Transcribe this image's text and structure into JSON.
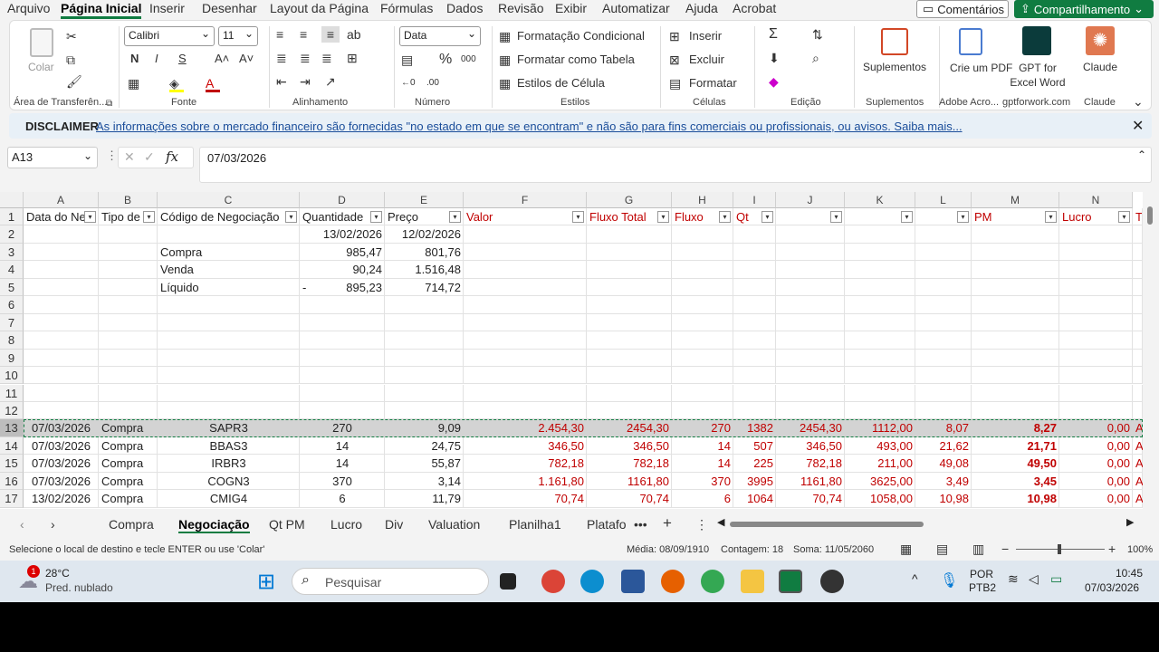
{
  "menu": [
    "Arquivo",
    "Página Inicial",
    "Inserir",
    "Desenhar",
    "Layout da Página",
    "Fórmulas",
    "Dados",
    "Revisão",
    "Exibir",
    "Automatizar",
    "Ajuda",
    "Acrobat"
  ],
  "comments_label": "Comentários",
  "share_label": "Compartilhamento",
  "ribbon": {
    "paste": "Colar",
    "clipboard": "Área de Transferên...",
    "font_name": "Calibri",
    "font_size": "11",
    "font_group": "Fonte",
    "align_group": "Alinhamento",
    "number_format": "Data",
    "number_group": "Número",
    "cond_format": "Formatação Condicional",
    "format_table": "Formatar como Tabela",
    "cell_styles": "Estilos de Célula",
    "styles_group": "Estilos",
    "insert": "Inserir",
    "delete": "Excluir",
    "format": "Formatar",
    "cells_group": "Células",
    "edit_group": "Edição",
    "addins": "Suplementos",
    "addins_group": "Suplementos",
    "pdf": "Crie um PDF",
    "pdf_group": "Adobe Acro...",
    "gpt": "GPT for Excel Word",
    "gpt_group": "gptforwork.com",
    "claude": "Claude",
    "claude_group": "Claude",
    "accent": "#107c41"
  },
  "disclaimer": {
    "title": "DISCLAIMER",
    "text": "As informações sobre o mercado financeiro são fornecidas \"no estado em que se encontram\" e não são para fins comerciais ou profissionais, ou avisos. Saiba mais..."
  },
  "formula": {
    "cell": "A13",
    "value": "07/03/2026"
  },
  "columns": [
    "A",
    "B",
    "C",
    "D",
    "E",
    "F",
    "G",
    "H",
    "I",
    "J",
    "K",
    "L",
    "M",
    "N"
  ],
  "rows": [
    "1",
    "2",
    "3",
    "4",
    "5",
    "6",
    "7",
    "8",
    "9",
    "10",
    "11",
    "12",
    "13",
    "14",
    "15",
    "16",
    "17"
  ],
  "headers": [
    "Data do Ne",
    "Tipo de",
    "Código de Negociação",
    "Quantidade",
    "Preço",
    "Valor",
    "Fluxo Total",
    "Fluxo",
    "Qt",
    "",
    "",
    "",
    "PM",
    "Lucro",
    "T"
  ],
  "summary": {
    "d2": "13/02/2026",
    "e2": "12/02/2026",
    "c3": "Compra",
    "d3": "985,47",
    "e3": "801,76",
    "c4": "Venda",
    "d4": "90,24",
    "e4": "1.516,48",
    "c5": "Líquido",
    "d5_sign": "-",
    "d5": "895,23",
    "e5": "714,72"
  },
  "data_rows": [
    [
      "07/03/2026",
      "Compra",
      "SAPR3",
      "270",
      "9,09",
      "2.454,30",
      "2454,30",
      "270",
      "1382",
      "2454,30",
      "1112,00",
      "8,07",
      "8,27",
      "0,00",
      "A"
    ],
    [
      "07/03/2026",
      "Compra",
      "BBAS3",
      "14",
      "24,75",
      "346,50",
      "346,50",
      "14",
      "507",
      "346,50",
      "493,00",
      "21,62",
      "21,71",
      "0,00",
      "A"
    ],
    [
      "07/03/2026",
      "Compra",
      "IRBR3",
      "14",
      "55,87",
      "782,18",
      "782,18",
      "14",
      "225",
      "782,18",
      "211,00",
      "49,08",
      "49,50",
      "0,00",
      "A"
    ],
    [
      "07/03/2026",
      "Compra",
      "COGN3",
      "370",
      "3,14",
      "1.161,80",
      "1161,80",
      "370",
      "3995",
      "1161,80",
      "3625,00",
      "3,49",
      "3,45",
      "0,00",
      "A"
    ],
    [
      "13/02/2026",
      "Compra",
      "CMIG4",
      "6",
      "11,79",
      "70,74",
      "70,74",
      "6",
      "1064",
      "70,74",
      "1058,00",
      "10,98",
      "10,98",
      "0,00",
      "A"
    ]
  ],
  "tabs": [
    "Compra",
    "Negociação",
    "Qt PM",
    "Lucro",
    "Div",
    "Valuation",
    "Planilha1",
    "Platafo"
  ],
  "status": {
    "msg": "Selecione o local de destino e tecle ENTER ou use 'Colar'",
    "media": "Média: 08/09/1910",
    "count": "Contagem: 18",
    "sum": "Soma: 11/05/2060",
    "zoom": "100%"
  },
  "taskbar": {
    "temp": "28°C",
    "weather": "Pred. nublado",
    "badge": "1",
    "search": "Pesquisar",
    "lang1": "POR",
    "lang2": "PTB2",
    "time": "10:45",
    "date": "07/03/2026"
  }
}
